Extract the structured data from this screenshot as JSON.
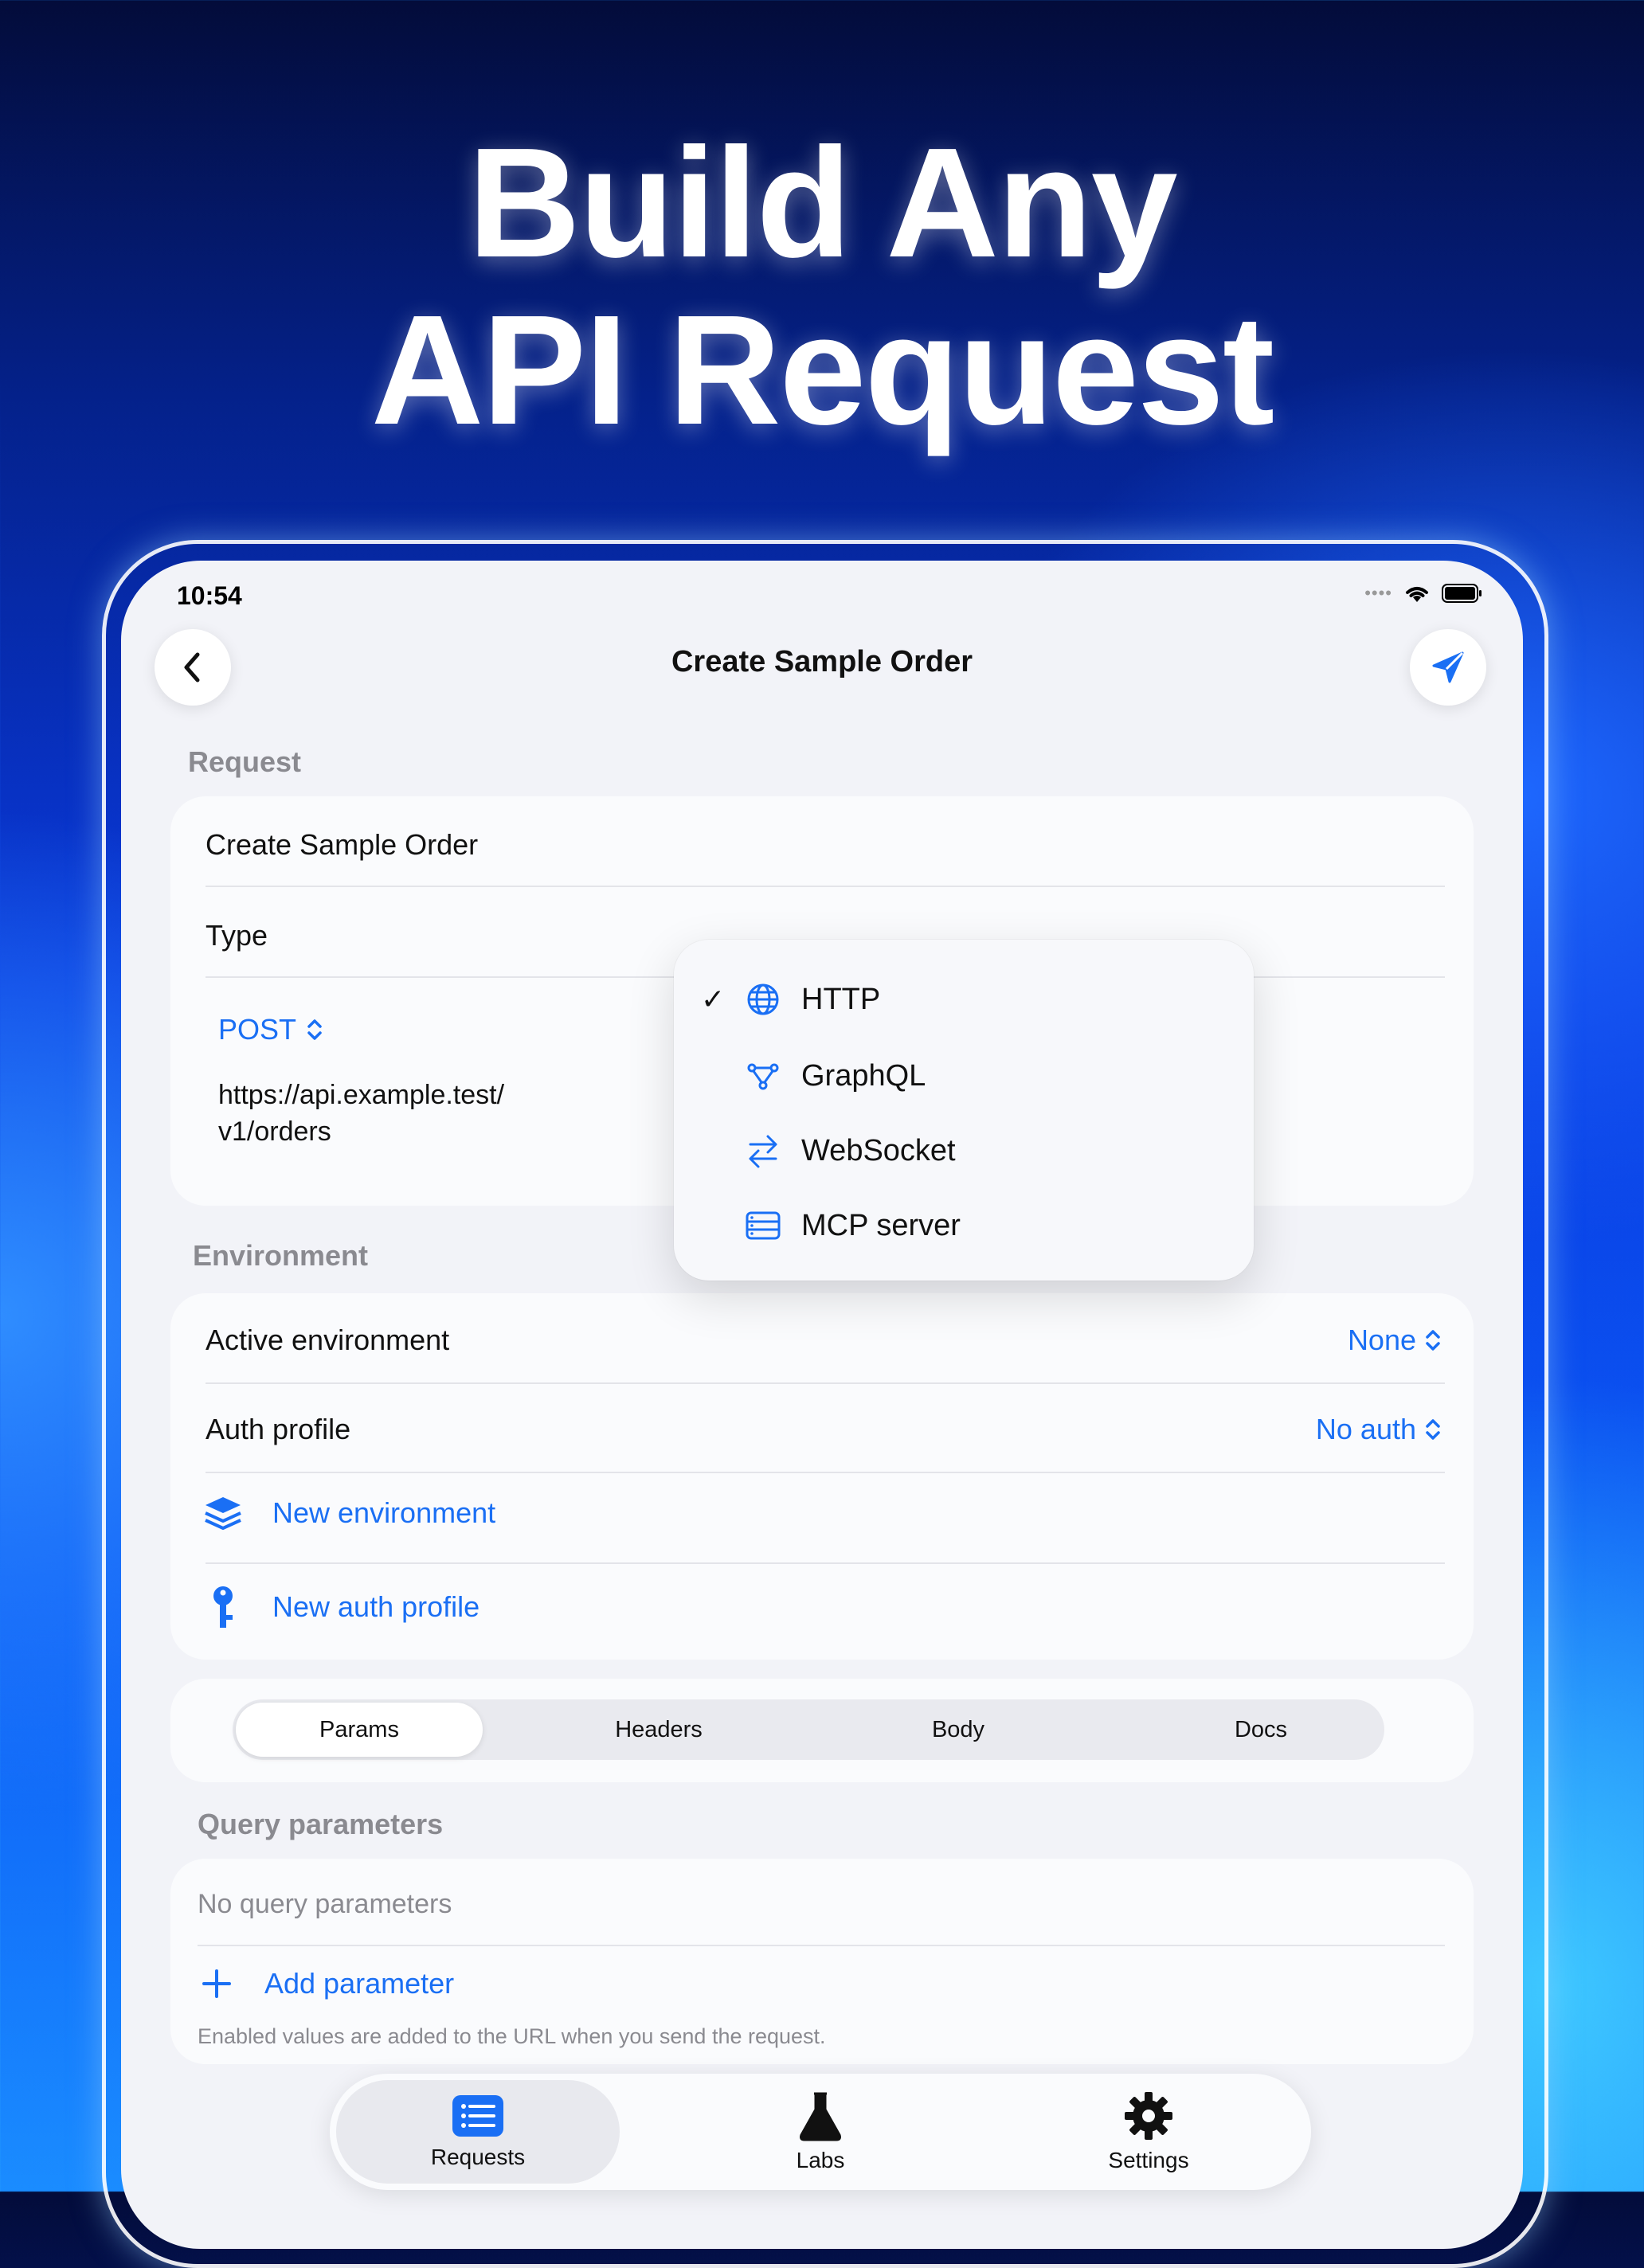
{
  "headline": {
    "line1": "Build Any",
    "line2": "API Request"
  },
  "status_bar": {
    "time": "10:54",
    "dots": "••••"
  },
  "nav": {
    "title": "Create Sample Order"
  },
  "request_section": {
    "label": "Request",
    "name": "Create Sample Order",
    "type_label": "Type",
    "method": "POST",
    "url_line1": "https://api.example.test/",
    "url_line2": "v1/orders"
  },
  "type_menu": {
    "selected": "HTTP",
    "items": [
      {
        "label": "HTTP",
        "icon": "globe-icon"
      },
      {
        "label": "GraphQL",
        "icon": "graph-icon"
      },
      {
        "label": "WebSocket",
        "icon": "arrows-icon"
      },
      {
        "label": "MCP server",
        "icon": "server-icon"
      }
    ],
    "check": "✓"
  },
  "environment_section": {
    "label": "Environment",
    "active_env_label": "Active environment",
    "active_env_value": "None",
    "auth_label": "Auth profile",
    "auth_value": "No auth",
    "new_env": "New environment",
    "new_auth": "New auth profile"
  },
  "segments": {
    "items": [
      "Params",
      "Headers",
      "Body",
      "Docs"
    ],
    "selected": "Params"
  },
  "query_section": {
    "label": "Query parameters",
    "empty": "No query parameters",
    "add": "Add parameter",
    "note": "Enabled values are added to the URL when you send the request."
  },
  "tabbar": {
    "items": [
      {
        "label": "Requests",
        "icon": "list-icon"
      },
      {
        "label": "Labs",
        "icon": "flask-icon"
      },
      {
        "label": "Settings",
        "icon": "gear-icon"
      }
    ],
    "selected": "Requests"
  },
  "colors": {
    "accent": "#1a6ff4",
    "background_top": "#030c3a",
    "background_bottom": "#1a8cff"
  }
}
